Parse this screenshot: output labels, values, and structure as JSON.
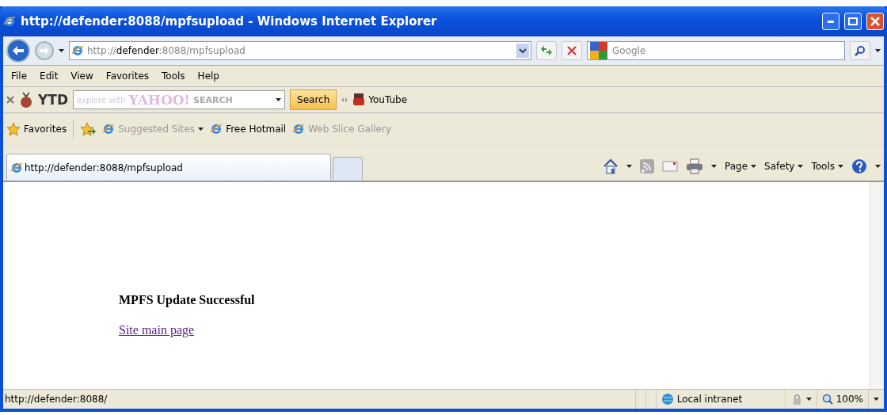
{
  "window": {
    "title": "http://defender:8088/mpfsupload - Windows Internet Explorer"
  },
  "address_bar": {
    "prefix": "http://",
    "host": "defender",
    "suffix": ":8088/mpfsupload"
  },
  "search_box": {
    "placeholder": "Google"
  },
  "menu": [
    "File",
    "Edit",
    "View",
    "Favorites",
    "Tools",
    "Help"
  ],
  "ytd_toolbar": {
    "logo": "YTD",
    "search_hint": "explore with",
    "brand": "YAHOO!",
    "brand_suffix": "SEARCH",
    "search_button": "Search",
    "youtube_link": "YouTube"
  },
  "favorites_bar": {
    "favorites": "Favorites",
    "links": [
      {
        "label": "Suggested Sites",
        "dropdown": true,
        "disabled": true
      },
      {
        "label": "Free Hotmail",
        "dropdown": false,
        "disabled": false
      },
      {
        "label": "Web Slice Gallery",
        "dropdown": false,
        "disabled": true
      }
    ]
  },
  "tabs": [
    {
      "label": "http://defender:8088/mpfsupload",
      "selected": true
    }
  ],
  "command_bar": [
    "Page",
    "Safety",
    "Tools"
  ],
  "page": {
    "heading": "MPFS Update Successful",
    "link": "Site main page"
  },
  "status_bar": {
    "url": "http://defender:8088/",
    "zone": "Local intranet",
    "zoom": "100%"
  }
}
